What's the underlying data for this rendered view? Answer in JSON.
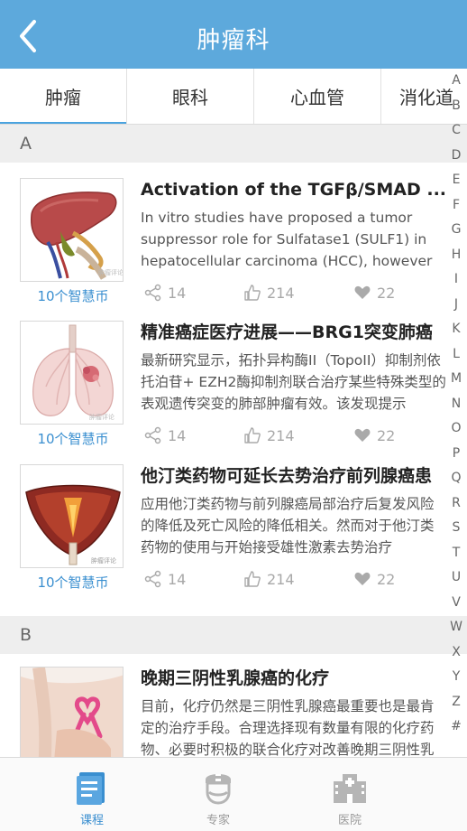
{
  "header": {
    "title": "肿瘤科"
  },
  "tabs": [
    {
      "label": "肿瘤",
      "active": true
    },
    {
      "label": "眼科",
      "active": false
    },
    {
      "label": "心血管",
      "active": false
    },
    {
      "label": "消化道",
      "active": false
    }
  ],
  "sections": [
    {
      "letter": "A",
      "items": [
        {
          "title": "Activation of the TGFβ/SMAD ......",
          "description": "In vitro studies have proposed a tumor suppressor role for Sulfatase1 (SULF1) in hepatocellular carcinoma (HCC), however ...",
          "price": "10个智慧币",
          "shares": "14",
          "likes": "214",
          "favorites": "22",
          "image": "liver-illustration"
        },
        {
          "title": "精准癌症医疗进展——BRG1突变肺癌",
          "description": "最新研究显示，拓扑异构酶II（TopoII）抑制剂依托泊苷+ EZH2酶抑制剂联合治疗某些特殊类型的表观遗传突变的肺部肿瘤有效。该发现提示",
          "price": "10个智慧币",
          "shares": "14",
          "likes": "214",
          "favorites": "22",
          "image": "lung-illustration"
        },
        {
          "title": "他汀类药物可延长去势治疗前列腺癌患",
          "description": "应用他汀类药物与前列腺癌局部治疗后复发风险的降低及死亡风险的降低相关。然而对于他汀类药物的使用与开始接受雄性激素去势治疗",
          "price": "10个智慧币",
          "shares": "14",
          "likes": "214",
          "favorites": "22",
          "image": "bladder-illustration"
        }
      ]
    },
    {
      "letter": "B",
      "items": [
        {
          "title": "晚期三阴性乳腺癌的化疗",
          "description": "目前，化疗仍然是三阴性乳腺癌最重要也是最肯定的治疗手段。合理选择现有数量有限的化疗药物、必要时积极的联合化疗对改善晚期三阴性乳",
          "image": "pink-ribbon-photo"
        }
      ]
    }
  ],
  "image_watermark": "肿瘤评论",
  "alphabet": [
    "A",
    "B",
    "C",
    "D",
    "E",
    "F",
    "G",
    "H",
    "I",
    "J",
    "K",
    "L",
    "M",
    "N",
    "O",
    "P",
    "Q",
    "R",
    "S",
    "T",
    "U",
    "V",
    "W",
    "X",
    "Y",
    "Z",
    "#"
  ],
  "bottom_nav": [
    {
      "label": "课程",
      "icon": "course-icon",
      "active": true
    },
    {
      "label": "专家",
      "icon": "expert-icon",
      "active": false
    },
    {
      "label": "医院",
      "icon": "hospital-icon",
      "active": false
    }
  ],
  "colors": {
    "header": "#5da9dc",
    "accent": "#3a8fd0",
    "tab_indicator": "#4aa3df",
    "section_bg": "#eeeeee"
  }
}
